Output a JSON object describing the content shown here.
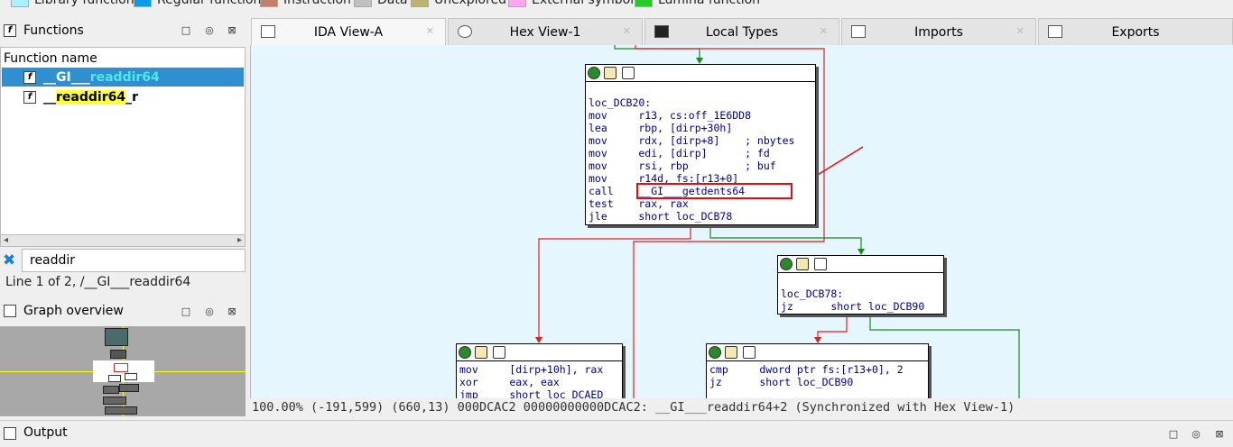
{
  "legend": [
    {
      "label": "Library function",
      "color": "#aaf0ff"
    },
    {
      "label": "Regular function",
      "color": "#0f9ae6"
    },
    {
      "label": "Instruction",
      "color": "#c0806a"
    },
    {
      "label": "Data",
      "color": "#c0c0c0"
    },
    {
      "label": "Unexplored",
      "color": "#b8b46e"
    },
    {
      "label": "External symbol",
      "color": "#ffa8f0"
    },
    {
      "label": "Lumina function",
      "color": "#22cc22"
    }
  ],
  "functions_panel": {
    "title": "Functions",
    "column_header": "Function name",
    "rows": [
      {
        "prefix": "__GI___",
        "match": "readdir64",
        "suffix": "",
        "selected": true
      },
      {
        "prefix": "__",
        "match": "readdir64",
        "suffix": "_r",
        "selected": false
      }
    ],
    "search_value": "readdir",
    "status": "Line 1 of 2, /__GI___readdir64"
  },
  "overview_panel": {
    "title": "Graph overview"
  },
  "tabs": [
    {
      "label": "IDA View-A",
      "active": true
    },
    {
      "label": "Hex View-1",
      "active": false
    },
    {
      "label": "Local Types",
      "active": false
    },
    {
      "label": "Imports",
      "active": false
    },
    {
      "label": "Exports",
      "active": false
    }
  ],
  "nodes": {
    "n1": {
      "lines": [
        {
          "t": "loc_DCB20:"
        },
        {
          "t": "mov     r13, cs:off_1E6DD8"
        },
        {
          "t": "lea     rbp, [dirp+30h]"
        },
        {
          "t": "mov     rdx, [dirp+8]    ; nbytes"
        },
        {
          "t": "mov     edi, [dirp]      ; fd"
        },
        {
          "t": "mov     rsi, rbp         ; buf"
        },
        {
          "t": "mov     r14d, fs:[r13+0]"
        },
        {
          "t": "call    __GI___getdents64"
        },
        {
          "t": "test    rax, rax"
        },
        {
          "t": "jle     short loc_DCB78"
        }
      ]
    },
    "n2": {
      "lines": [
        {
          "t": "loc_DCB78:"
        },
        {
          "t": "jz      short loc_DCB90"
        }
      ]
    },
    "n3": {
      "lines": [
        {
          "t": "mov     [dirp+10h], rax"
        },
        {
          "t": "xor     eax, eax"
        },
        {
          "t": "jmp     short loc_DCAED"
        }
      ]
    },
    "n4": {
      "lines": [
        {
          "t": "cmp     dword ptr fs:[r13+0], 2"
        },
        {
          "t": "jz      short loc_DCB90"
        }
      ]
    }
  },
  "status_bar": "100.00% (-191,599) (660,13) 000DCAC2 00000000000DCAC2: __GI___readdir64+2 (Synchronized with Hex View-1)",
  "output_panel": {
    "title": "Output"
  }
}
